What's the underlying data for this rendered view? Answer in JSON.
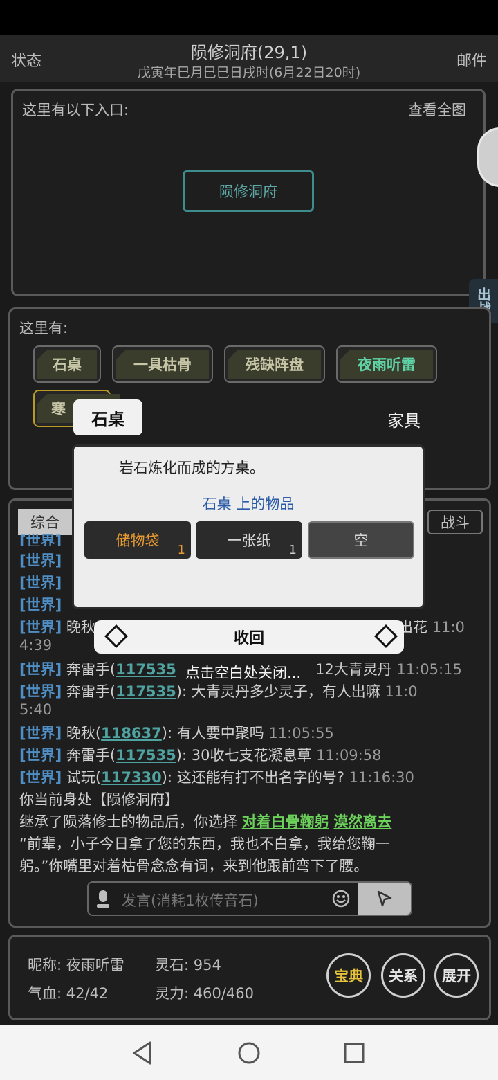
{
  "header": {
    "left": "状态",
    "right": "邮件",
    "title": "陨修洞府(29,1)",
    "subtitle": "戊寅年巳月巳巳日戌时(6月22日20时)"
  },
  "entrances": {
    "label": "这里有以下入口:",
    "view_all": "查看全图",
    "button": "陨修洞府"
  },
  "side_badge": "出战",
  "here": {
    "label": "这里有:",
    "items": [
      "石桌",
      "一具枯骨",
      "残缺阵盘",
      "夜雨听雷",
      "寒"
    ]
  },
  "chat": {
    "tab_left": "综合",
    "tab_right": "战斗",
    "world_tag": "[世界]",
    "lines": {
      "l4_name": "晚秋",
      "l4_tail": "出花",
      "l4_time": "11:0",
      "l4_cont": "4:39",
      "l5_name": "奔雷手",
      "l5_id": "117535",
      "l5_msg": "12大青灵丹",
      "l5_time": "11:05:15",
      "l6_name": "奔雷手",
      "l6_id": "117535",
      "l6_msg": "大青灵丹多少灵子，有人出嘛",
      "l6_time": "11:0",
      "l6_cont": "5:40",
      "l7_name": "晚秋",
      "l7_id": "118637",
      "l7_msg": "有人要中聚吗",
      "l7_time": "11:05:55",
      "l8_name": "奔雷手",
      "l8_id": "117535",
      "l8_msg": "30收七支花凝息草",
      "l8_time": "11:09:58",
      "l9_name": "试玩",
      "l9_id": "117330",
      "l9_msg": "这还能有打不出名字的号?",
      "l9_time": "11:16:30"
    },
    "location": "你当前身处【陨修洞府】",
    "story_prefix": "继承了陨落修士的物品后，你选择",
    "choice1": "对着白骨鞠躬",
    "choice2": "漠然离去",
    "story_2": "“前辈，小子今日拿了您的东西，我也不白拿，我给您鞠一",
    "story_3": "躬。”你嘴里对着枯骨念念有词，来到他跟前弯下了腰。",
    "input_placeholder": "发言(消耗1枚传音石)"
  },
  "stats": {
    "nick_label": "昵称:",
    "nick": "夜雨听雷",
    "stone_label": "灵石:",
    "stone": "954",
    "hp_label": "气血:",
    "hp": "42/42",
    "mp_label": "灵力:",
    "mp": "460/460",
    "btn1": "宝典",
    "btn2": "关系",
    "btn3": "展开"
  },
  "popup": {
    "title": "石桌",
    "type": "家具",
    "desc": "岩石炼化而成的方桌。",
    "sub": "石桌 上的物品",
    "slots": [
      {
        "label": "储物袋",
        "count": "1"
      },
      {
        "label": "一张纸",
        "count": "1"
      },
      {
        "label": "空"
      }
    ],
    "collapse": "收回",
    "close_hint": "点击空白处关闭..."
  },
  "colors": {
    "world_tag": "#4f8fc5",
    "player_id": "#4fa3a0",
    "choice": "#6cd15a",
    "gold": "#e8c23a"
  }
}
